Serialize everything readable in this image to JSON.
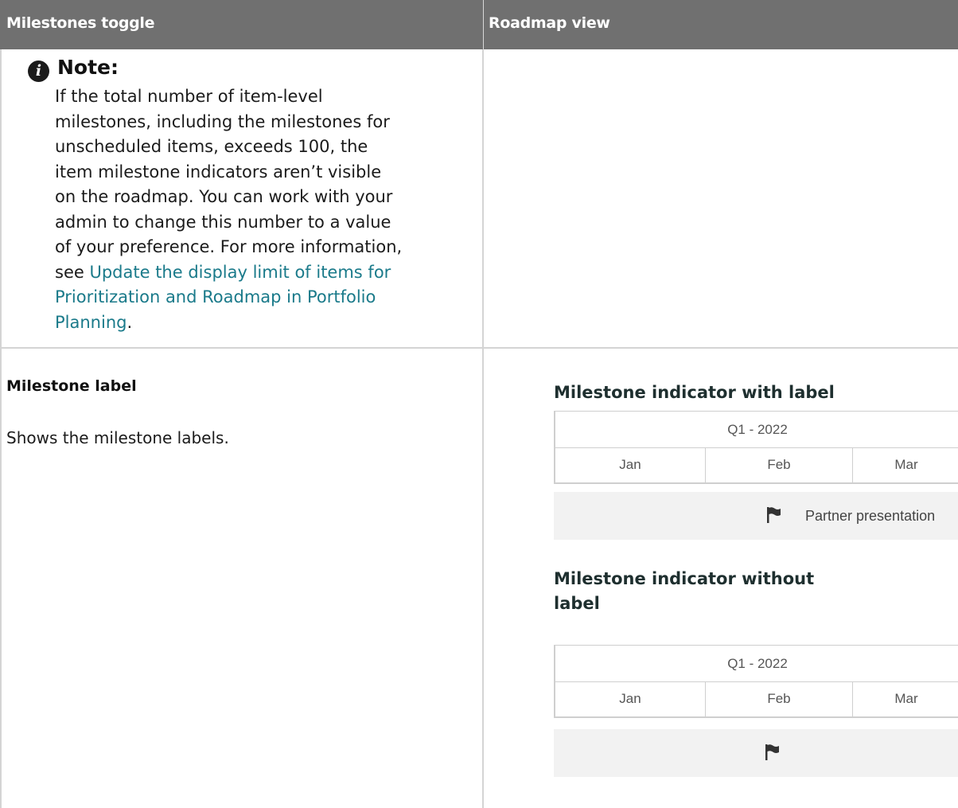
{
  "header": {
    "col1": "Milestones toggle",
    "col2": "Roadmap view"
  },
  "note": {
    "icon": "info-icon",
    "title": "Note:",
    "body_lines": [
      "If the total number of item-level",
      "milestones, including the milestones for",
      "unscheduled items, exceeds 100, the",
      "item milestone indicators aren’t visible",
      "on the roadmap. You can work with your",
      "admin to change this number to a value",
      "of your preference. For more information,"
    ],
    "link_prefix": "see ",
    "link_line1": "Update the display limit of items for",
    "link_line2": "Prioritization and Roadmap in Portfolio",
    "link_line3": "Planning",
    "link_suffix": "."
  },
  "row": {
    "title": "Milestone label",
    "description": "Shows the milestone labels."
  },
  "figure_with_label": {
    "title": "Milestone indicator with label",
    "quarter": "Q1 - 2022",
    "months": [
      "Jan",
      "Feb",
      "Mar"
    ],
    "milestone_label": "Partner presentation"
  },
  "figure_without_label": {
    "title_line1": "Milestone indicator without",
    "title_line2": "label",
    "quarter": "Q1 - 2022",
    "months": [
      "Jan",
      "Feb",
      "Mar"
    ]
  },
  "colors": {
    "header_bg": "#707070",
    "link": "#1a7a8a",
    "band": "#f2f2f2"
  }
}
